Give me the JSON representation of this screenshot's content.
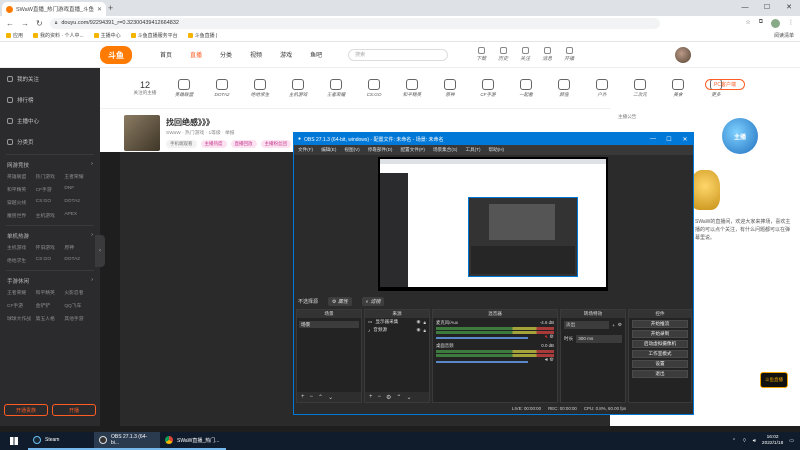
{
  "browser": {
    "tab_title": "SWaW直播_热门游戏直播_斗鱼",
    "url": "douyu.com/92294391_r=0.32300439412664832",
    "bookmarks": [
      "应用",
      "我的资料 · 个人中...",
      "主播中心",
      "斗鱼直播服务平台",
      "斗鱼直播 | "
    ],
    "bookmarks_right": "阅读清单"
  },
  "site": {
    "logo": "斗鱼",
    "topnav": [
      "首页",
      "直播",
      "分类",
      "视频",
      "游戏",
      "鱼吧"
    ],
    "topnav_active": 1,
    "search_placeholder": "搜索",
    "head_icons": [
      "下载",
      "历史",
      "关注",
      "消息",
      "开播"
    ],
    "sidebar_items": [
      "我的关注",
      "排行榜",
      "主播中心",
      "分类页"
    ],
    "sidebar_groups": [
      {
        "title": "网游竞技",
        "items": [
          "英雄联盟",
          "热门游戏",
          "王者荣耀",
          "和平精英",
          "CF手游",
          "DNF",
          "穿越火线",
          "CS:GO",
          "DOTA2",
          "魔兽世界",
          "主机游戏",
          "APEX"
        ]
      },
      {
        "title": "单机热游",
        "items": [
          "主机游戏",
          "怀旧游戏",
          "原神",
          "绝地求生",
          "CS:GO",
          "DOTA2"
        ]
      },
      {
        "title": "手游休闲",
        "items": [
          "王者荣耀",
          "和平精英",
          "火影忍者",
          "CF手游",
          "金铲铲",
          "QQ飞车",
          "球球大作战",
          "第五人格",
          "其他手游"
        ]
      }
    ],
    "sidebar_buttons": [
      "开通贵族",
      "开播"
    ],
    "follow_count": "12",
    "follow_label": "关注的主播",
    "subnav": [
      "英雄联盟",
      "DOTA2",
      "绝地求生",
      "主机游戏",
      "王者荣耀",
      "CS:GO",
      "和平精英",
      "原神",
      "CF手游",
      "一起看",
      "颜值",
      "户外",
      "二次元",
      "美食",
      "更多"
    ],
    "pc_client": "PC客户端",
    "room_title": "找回绝感》》》",
    "room_meta": "SWaW · 热门游戏 · 1等级 · 举报",
    "room_tags": [
      "手机端观看",
      "主播热度",
      "直播回放",
      "主播粉丝团"
    ],
    "side_bubbles": [
      "主播公告",
      "排行榜",
      "贡献榜"
    ],
    "anchor_desc": "SWaW的直播间，欢迎大家来捧场，喜欢主播的可以点个关注，有什么问题都可以在弹幕里说。",
    "mascot": "主播",
    "badge": "斗鱼直播"
  },
  "obs": {
    "title": "OBS 27.1.3 (64-bit, windows) - 配置文件: 未命名 - 场景: 未命名",
    "menu": [
      "文件(F)",
      "编辑(E)",
      "视图(V)",
      "停靠部件(D)",
      "配置文件(P)",
      "场景集合(S)",
      "工具(T)",
      "帮助(H)"
    ],
    "scenebar_label": "不选择源",
    "scenebar_buttons": [
      "属性",
      "滤镜"
    ],
    "docks": {
      "scenes": "场景",
      "sources": "来源",
      "mixer": "混音器",
      "transitions": "转场特效",
      "controls": "控件"
    },
    "scene_items": [
      "场景"
    ],
    "source_items": [
      "显示器采集",
      "音频源"
    ],
    "mixer_rows": [
      {
        "name": "麦克风/Aux",
        "db": "-4.6 dB"
      },
      {
        "name": "桌面音频",
        "db": "0.0 dB"
      }
    ],
    "transition": {
      "type": "淡出",
      "duration_label": "时长",
      "duration": "300 ms"
    },
    "controls": [
      "开始推流",
      "开始录制",
      "启动虚拟摄像机",
      "工作室模式",
      "设置",
      "退出"
    ],
    "status": [
      "LIVE: 00:00:00",
      "REC: 00:00:00",
      "CPU: 0.8%, 60.00 fps"
    ]
  },
  "taskbar": {
    "apps": [
      "Steam",
      "OBS 27.1.3 (64-bi...",
      "SWaW直播_热门..."
    ],
    "time": "16:02",
    "date": "2022/1/18"
  }
}
